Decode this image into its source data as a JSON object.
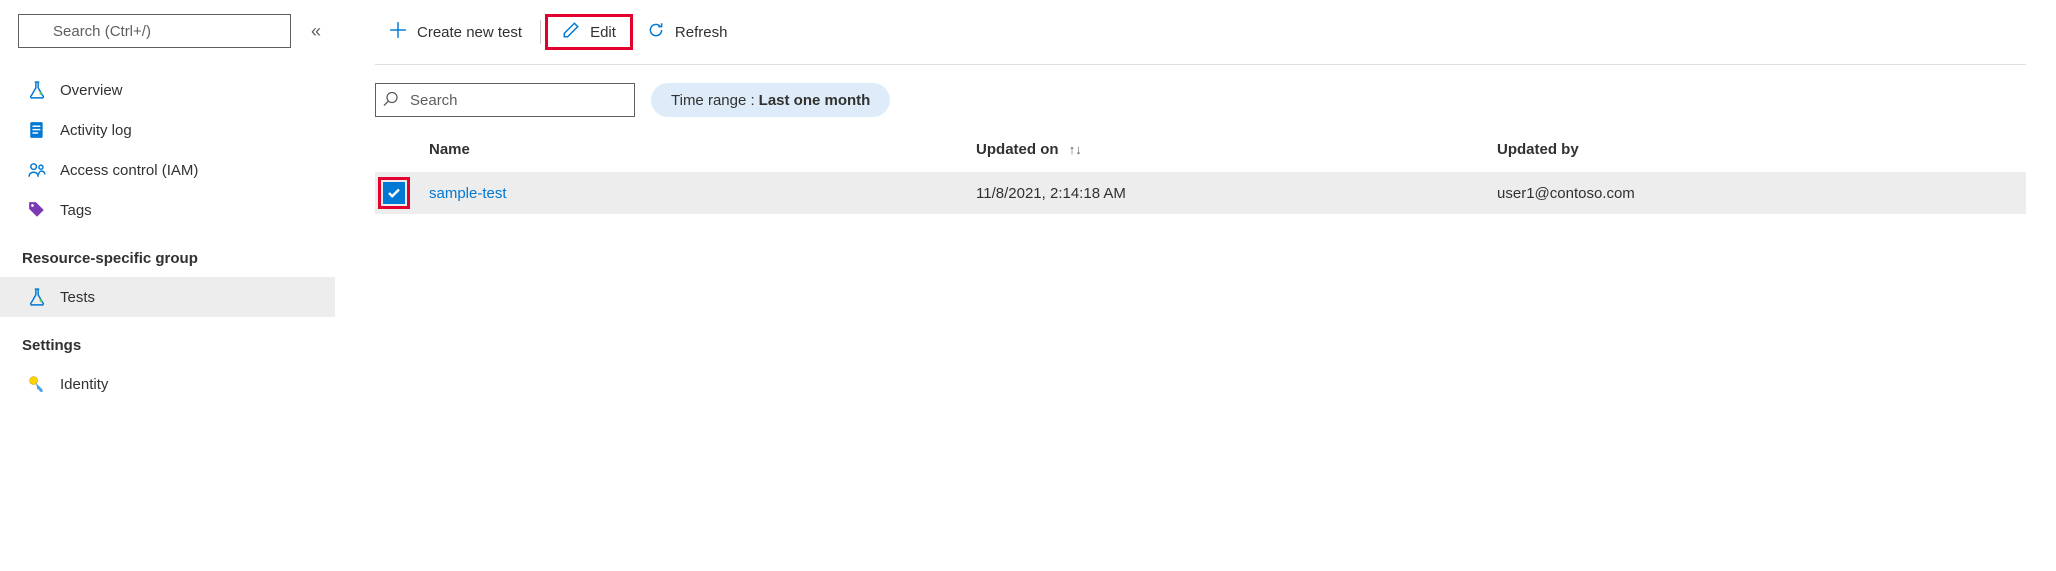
{
  "sidebar": {
    "search_placeholder": "Search (Ctrl+/)",
    "items": [
      {
        "label": "Overview"
      },
      {
        "label": "Activity log"
      },
      {
        "label": "Access control (IAM)"
      },
      {
        "label": "Tags"
      }
    ],
    "group_title": "Resource-specific group",
    "group_items": [
      {
        "label": "Tests"
      }
    ],
    "settings_title": "Settings",
    "settings_items": [
      {
        "label": "Identity"
      }
    ]
  },
  "toolbar": {
    "create_label": "Create new test",
    "edit_label": "Edit",
    "refresh_label": "Refresh"
  },
  "filter": {
    "search_placeholder": "Search",
    "time_range_label": "Time range :",
    "time_range_value": "Last one month"
  },
  "table": {
    "col_name": "Name",
    "col_updated_on": "Updated on",
    "col_updated_by": "Updated by",
    "rows": [
      {
        "name": "sample-test",
        "updated_on": "11/8/2021, 2:14:18 AM",
        "updated_by": "user1@contoso.com",
        "checked": true
      }
    ]
  }
}
